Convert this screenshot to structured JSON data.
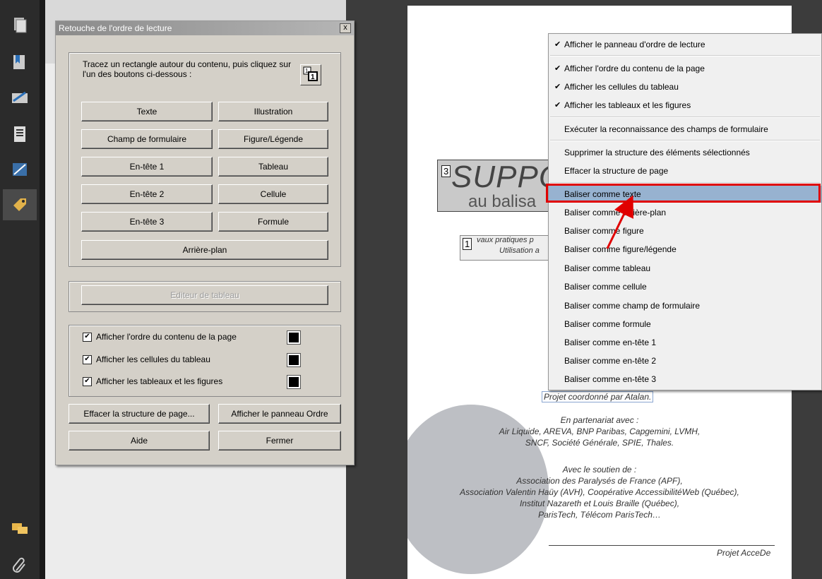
{
  "dialog": {
    "title": "Retouche de l'ordre de lecture",
    "close_label": "x",
    "instruction": "Tracez un rectangle autour du contenu, puis cliquez sur l'un des boutons ci-dessous :",
    "buttons": {
      "texte": "Texte",
      "illustration": "Illustration",
      "champ": "Champ de formulaire",
      "figure_legende": "Figure/Légende",
      "entete1": "En-tête 1",
      "tableau": "Tableau",
      "entete2": "En-tête 2",
      "cellule": "Cellule",
      "entete3": "En-tête 3",
      "formule": "Formule",
      "arriere_plan": "Arrière-plan",
      "editeur_tableau": "Editeur de tableau",
      "effacer": "Effacer la structure de page...",
      "afficher_panneau": "Afficher le panneau Ordre",
      "aide": "Aide",
      "fermer": "Fermer"
    },
    "checkboxes": [
      {
        "label": "Afficher l'ordre du contenu de la page",
        "checked": true
      },
      {
        "label": "Afficher les cellules du tableau",
        "checked": true
      },
      {
        "label": "Afficher les tableaux et les figures",
        "checked": true
      }
    ]
  },
  "context_menu": {
    "items": [
      {
        "label": "Afficher le panneau d'ordre de lecture",
        "checked": true
      },
      {
        "label": "Afficher l'ordre du contenu de la page",
        "checked": true
      },
      {
        "label": "Afficher les cellules du tableau",
        "checked": true
      },
      {
        "label": "Afficher les tableaux et les figures",
        "checked": true
      },
      {
        "label": "Exécuter la reconnaissance des champs de formulaire",
        "checked": false
      },
      {
        "label": "Supprimer la structure des éléments sélectionnés",
        "checked": false
      },
      {
        "label": "Effacer la structure de page",
        "checked": false
      },
      {
        "label": "Baliser comme texte",
        "checked": false,
        "highlighted": true
      },
      {
        "label": "Baliser comme arrière-plan",
        "checked": false
      },
      {
        "label": "Baliser comme figure",
        "checked": false
      },
      {
        "label": "Baliser comme figure/légende",
        "checked": false
      },
      {
        "label": "Baliser comme tableau",
        "checked": false
      },
      {
        "label": "Baliser comme cellule",
        "checked": false
      },
      {
        "label": "Baliser comme champ de formulaire",
        "checked": false
      },
      {
        "label": "Baliser comme formule",
        "checked": false
      },
      {
        "label": "Baliser comme en-tête 1",
        "checked": false
      },
      {
        "label": "Baliser comme en-tête 2",
        "checked": false
      },
      {
        "label": "Baliser comme en-tête 3",
        "checked": false
      }
    ],
    "check_glyph": "✔"
  },
  "document": {
    "title_fragment": "SUPPO",
    "subtitle_fragment": "au balisa",
    "box_number_3": "3",
    "box_number_1": "1",
    "small_line1": "vaux pratiques p",
    "small_line2": "Utilisation a",
    "projet_coord": "Projet coordonné par Atalan.",
    "partenariat_title": "En partenariat avec :",
    "partenariat_line1": "Air Liquide, AREVA, BNP Paribas, Capgemini, LVMH,",
    "partenariat_line2": "SNCF, Société Générale, SPIE, Thales.",
    "soutien_title": "Avec le soutien de :",
    "soutien_line1": "Association des Paralysés de France (APF),",
    "soutien_line2": "Association Valentin Haüy (AVH), Coopérative AccessibilitéWeb (Québec),",
    "soutien_line3": "Institut Nazareth et Louis Braille (Québec),",
    "soutien_line4": "ParisTech, Télécom ParisTech…",
    "footer": "Projet AcceDe"
  },
  "highlight_color": "#e00000",
  "toolbar_icons": [
    "pages-icon",
    "bookmarks-icon",
    "signature-icon",
    "document-icon",
    "layers-icon",
    "tag-icon",
    "comment-icon",
    "attachment-icon"
  ]
}
